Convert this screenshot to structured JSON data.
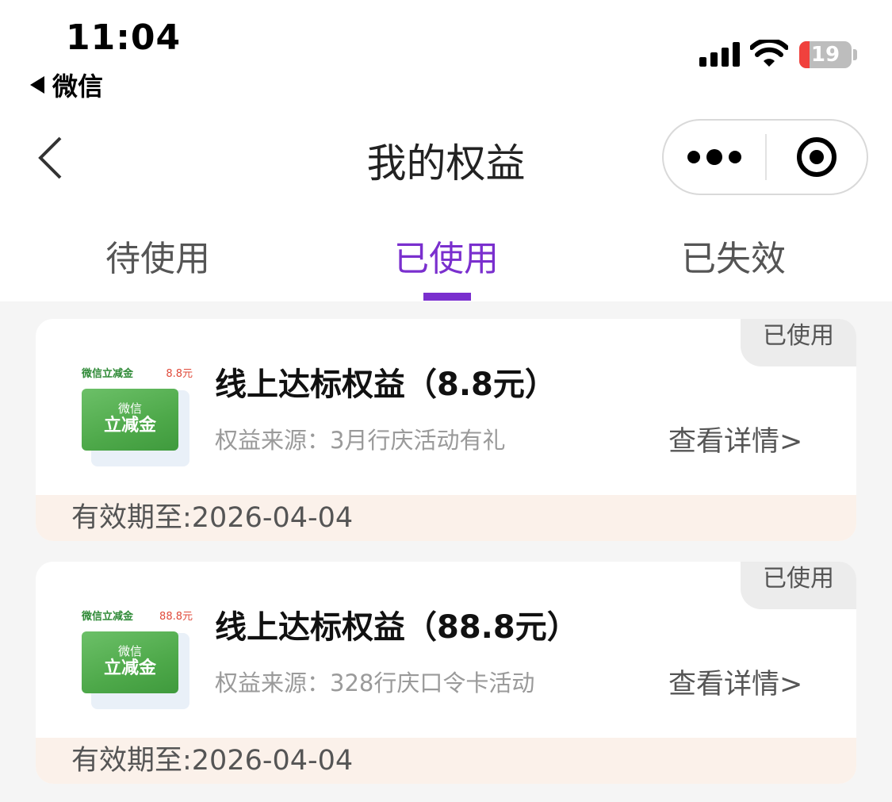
{
  "status_bar": {
    "time": "11:04",
    "back_app_label": "微信",
    "battery_level": 19,
    "battery_text": "19"
  },
  "nav": {
    "title": "我的权益",
    "more_icon": "more-dots-icon",
    "close_icon": "target-icon"
  },
  "tabs": [
    {
      "label": "待使用",
      "active": false
    },
    {
      "label": "已使用",
      "active": true
    },
    {
      "label": "已失效",
      "active": false
    }
  ],
  "colors": {
    "accent": "#7a2fce",
    "expiry_band": "#fbf1ea",
    "coupon_green": "#4ea94a"
  },
  "cards": [
    {
      "status": "已使用",
      "thumb_label_left": "微信立减金",
      "thumb_label_right": "8.8元",
      "thumb_line1": "微信",
      "thumb_line2": "立减金",
      "title": "线上达标权益（8.8元）",
      "source": "权益来源：3月行庆活动有礼",
      "detail_link": "查看详情>",
      "expiry": "有效期至:2026-04-04"
    },
    {
      "status": "已使用",
      "thumb_label_left": "微信立减金",
      "thumb_label_right": "88.8元",
      "thumb_line1": "微信",
      "thumb_line2": "立减金",
      "title": "线上达标权益（88.8元）",
      "source": "权益来源：328行庆口令卡活动",
      "detail_link": "查看详情>",
      "expiry": "有效期至:2026-04-04"
    }
  ]
}
